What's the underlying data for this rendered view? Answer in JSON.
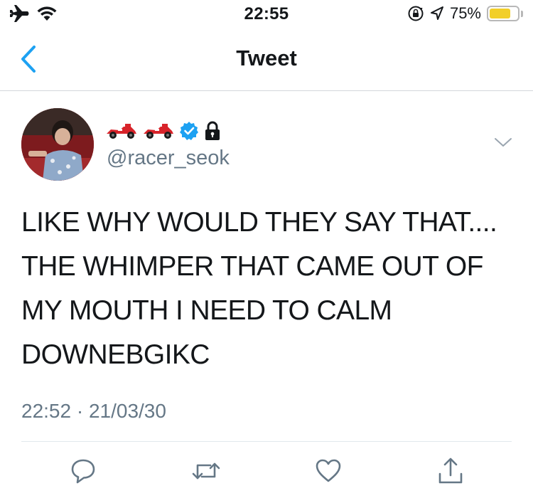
{
  "status_bar": {
    "time": "22:55",
    "battery_percent": "75%",
    "battery_level": 0.75,
    "icons": [
      "airplane-icon",
      "wifi-icon",
      "rotation-lock-icon",
      "location-icon",
      "battery-icon"
    ]
  },
  "nav": {
    "title": "Tweet",
    "back_icon": "chevron-left-icon"
  },
  "tweet": {
    "display_name_icons": [
      "racing-car-icon",
      "racing-car-icon",
      "verified-badge-icon",
      "lock-icon"
    ],
    "handle": "@racer_seok",
    "text": "LIKE WHY WOULD THEY SAY THAT....\nTHE WHIMPER THAT CAME OUT OF\nMY MOUTH I NEED TO CALM\nDOWNEBGIKC",
    "timestamp": "22:52 · 21/03/30"
  },
  "actions": [
    "reply-icon",
    "retweet-icon",
    "like-icon",
    "share-icon"
  ],
  "colors": {
    "accent": "#1da1f2",
    "secondary_text": "#657786",
    "icon_gray": "#657786",
    "battery_fill": "#f2cf29"
  }
}
